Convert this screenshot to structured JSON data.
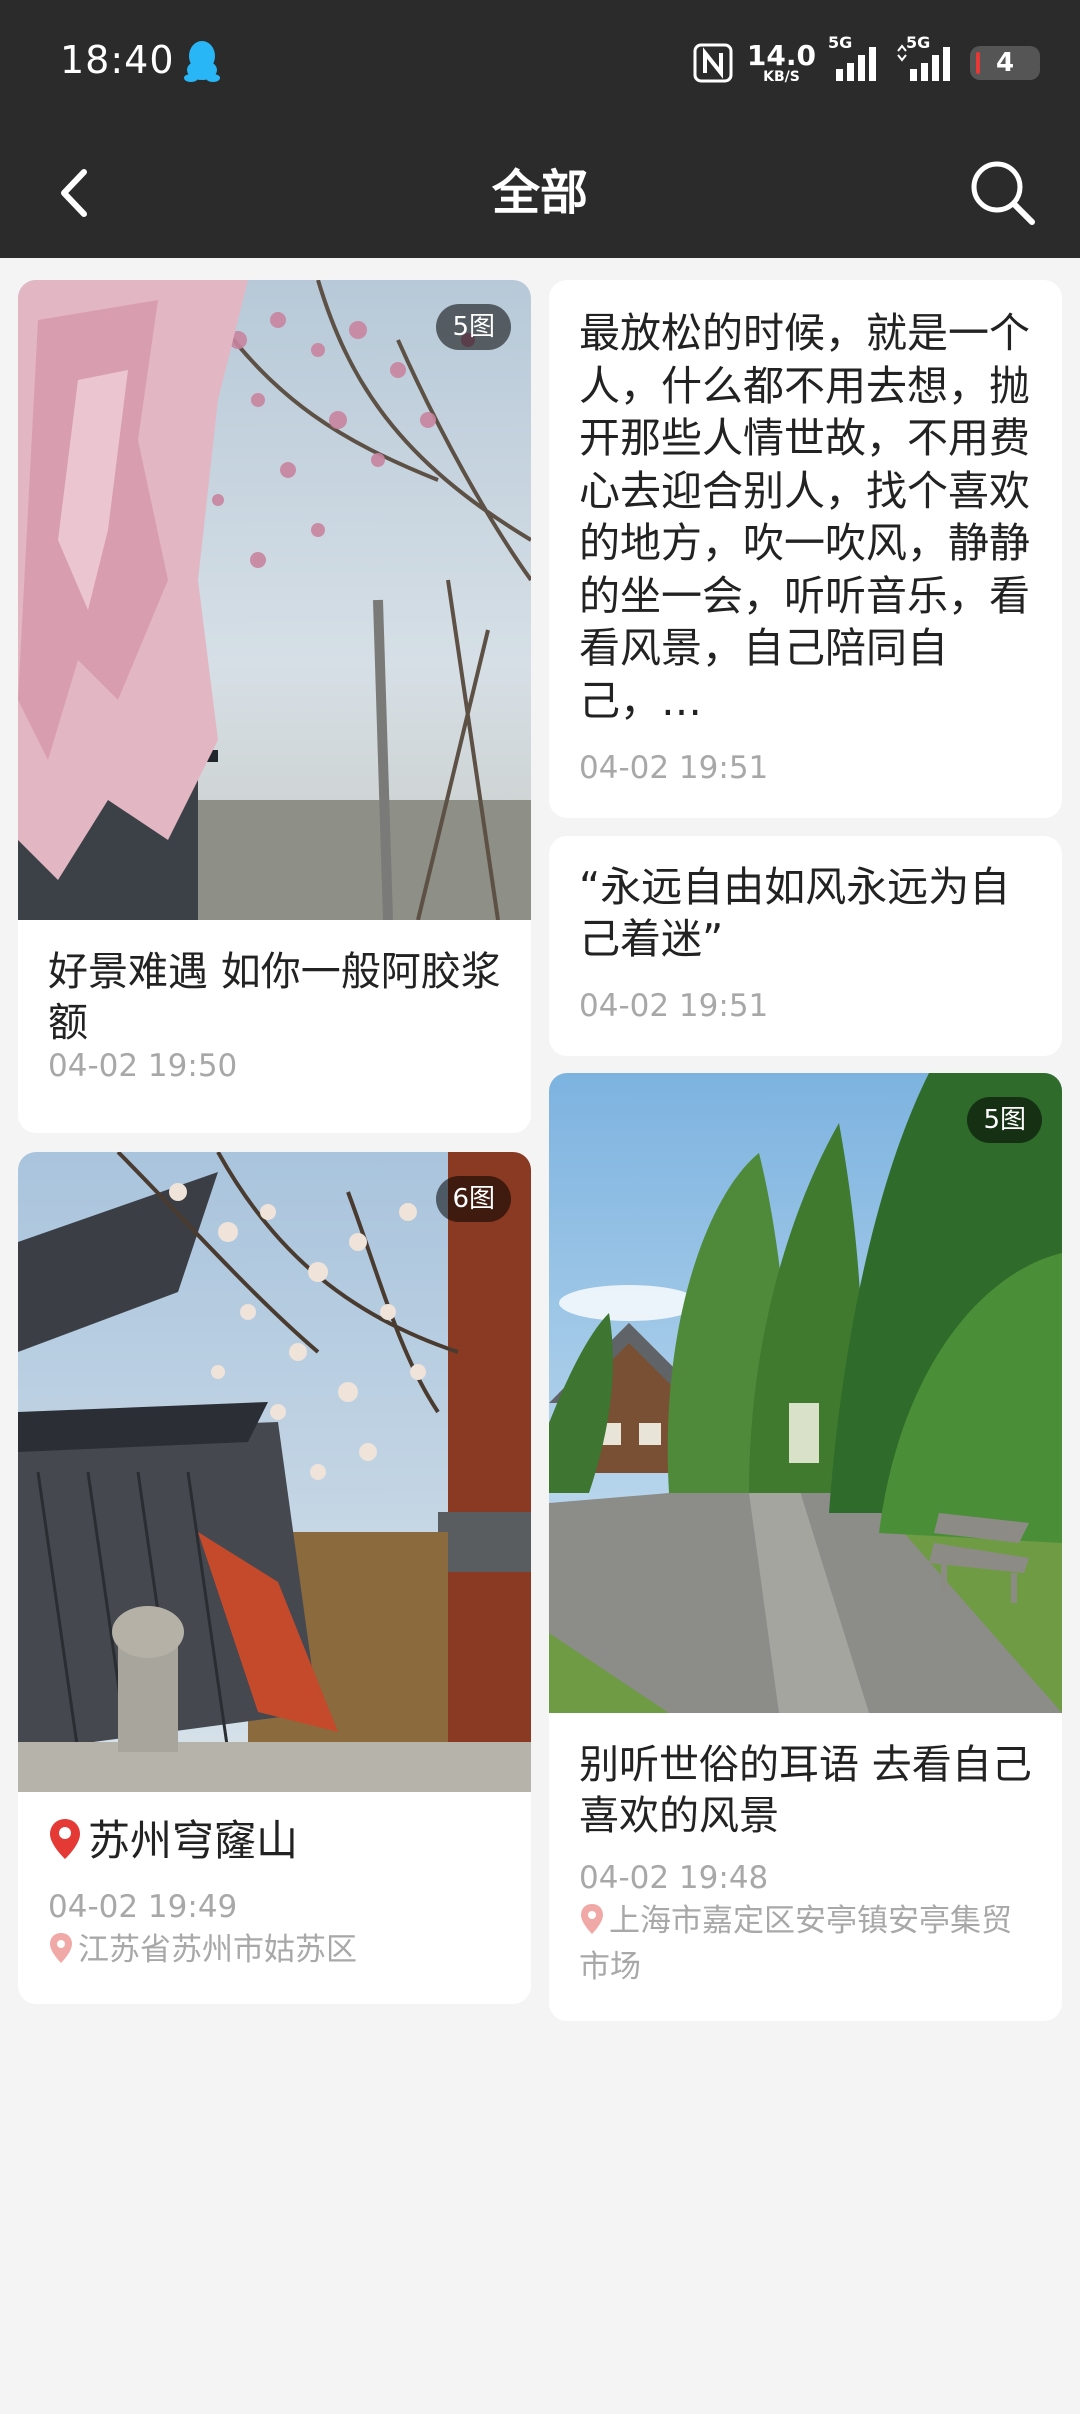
{
  "status_bar": {
    "time": "18:40",
    "network_speed": "14.0",
    "network_speed_unit": "KB/S",
    "signal1_label": "5G",
    "signal2_label": "5G",
    "battery": "4",
    "icons": [
      "qq-icon",
      "nfc-icon",
      "signal-icon",
      "battery-icon"
    ]
  },
  "header": {
    "title": "全部",
    "back_icon": "chevron-left-icon",
    "search_icon": "search-icon"
  },
  "colors": {
    "header_bg": "#2b2b2b",
    "page_bg": "#f4f4f4",
    "card_bg": "#ffffff",
    "time_text": "#a8a8a8",
    "pin_red": "#e53935"
  },
  "posts": [
    {
      "badge": "5图",
      "title": "好景难遇 如你一般阿胶浆额",
      "time": "04-02 19:50",
      "image": "pink magnolia blossoms"
    },
    {
      "text": "最放松的时候，就是一个人，什么都不用去想，抛开那些人情世故，不用费心去迎合别人，找个喜欢的地方，吹一吹风，静静的坐一会，听听音乐，看看风景，自己陪同自己，…",
      "time": "04-02 19:51"
    },
    {
      "text": "“永远自由如风永远为自己着迷”",
      "time": "04-02 19:51"
    },
    {
      "badge": "6图",
      "title": "苏州穹窿山",
      "time": "04-02 19:49",
      "location": "江苏省苏州市姑苏区",
      "image": "temple roof and magnolia"
    },
    {
      "badge": "5图",
      "title": "别听世俗的耳语 去看自己喜欢的风景",
      "time": "04-02 19:48",
      "location": "上海市嘉定区安亭镇安亭集贸市场",
      "image": "forest path and cabin"
    }
  ]
}
